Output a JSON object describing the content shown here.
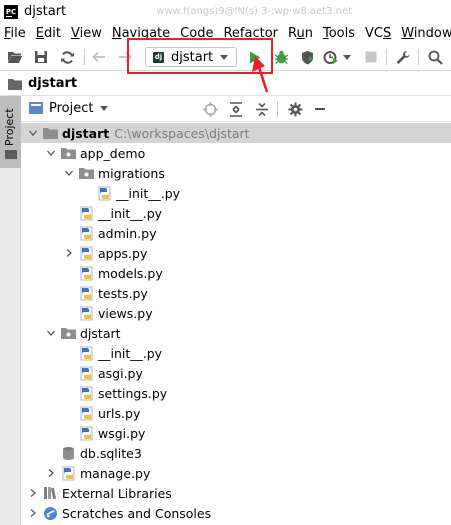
{
  "window": {
    "title": "djstart",
    "title_ghost": "  www.f(angs)9@lN(s) 3-:wp·w8.aet3.net"
  },
  "menu": [
    "File",
    "Edit",
    "View",
    "Navigate",
    "Code",
    "Refactor",
    "Run",
    "Tools",
    "VCS",
    "Window"
  ],
  "menu_mnemonics": [
    "F",
    "E",
    "V",
    "N",
    "C",
    "R",
    "u",
    "T",
    "S",
    "W"
  ],
  "toolbar": {
    "run_config_label": "djstart",
    "buttons": [
      "open-folder-icon",
      "save-icon",
      "sync-icon",
      "back-icon",
      "forward-icon",
      "run-icon",
      "debug-icon",
      "coverage-icon",
      "profile-icon",
      "stop-icon",
      "wrench-icon",
      "search-icon"
    ]
  },
  "breadcrumb": {
    "label": "djstart"
  },
  "side_strip": {
    "tab_label": "Project"
  },
  "panel": {
    "title": "Project"
  },
  "tree": [
    {
      "label": "djstart",
      "path": "C:\\workspaces\\djstart",
      "level": 0,
      "expanded": true,
      "type": "folder",
      "bold": true,
      "selected": true
    },
    {
      "label": "app_demo",
      "level": 1,
      "expanded": true,
      "type": "package"
    },
    {
      "label": "migrations",
      "level": 2,
      "expanded": true,
      "type": "package"
    },
    {
      "label": "__init__.py",
      "level": 3,
      "type": "py"
    },
    {
      "label": "__init__.py",
      "level": 2,
      "type": "py"
    },
    {
      "label": "admin.py",
      "level": 2,
      "type": "py"
    },
    {
      "label": "apps.py",
      "level": 2,
      "expanded": false,
      "type": "py"
    },
    {
      "label": "models.py",
      "level": 2,
      "type": "py"
    },
    {
      "label": "tests.py",
      "level": 2,
      "type": "py"
    },
    {
      "label": "views.py",
      "level": 2,
      "type": "py"
    },
    {
      "label": "djstart",
      "level": 1,
      "expanded": true,
      "type": "package"
    },
    {
      "label": "__init__.py",
      "level": 2,
      "type": "py"
    },
    {
      "label": "asgi.py",
      "level": 2,
      "type": "py"
    },
    {
      "label": "settings.py",
      "level": 2,
      "type": "py"
    },
    {
      "label": "urls.py",
      "level": 2,
      "type": "py"
    },
    {
      "label": "wsgi.py",
      "level": 2,
      "type": "py"
    },
    {
      "label": "db.sqlite3",
      "level": 1,
      "type": "db"
    },
    {
      "label": "manage.py",
      "level": 1,
      "expanded": false,
      "type": "py"
    },
    {
      "label": "External Libraries",
      "level": 0,
      "expanded": false,
      "type": "libraries"
    },
    {
      "label": "Scratches and Consoles",
      "level": 0,
      "expanded": false,
      "type": "scratches"
    }
  ],
  "colors": {
    "highlight": "#e8202a",
    "run_green": "#3f9b45",
    "py_blue": "#3f73b8",
    "py_yellow": "#f2c230"
  }
}
